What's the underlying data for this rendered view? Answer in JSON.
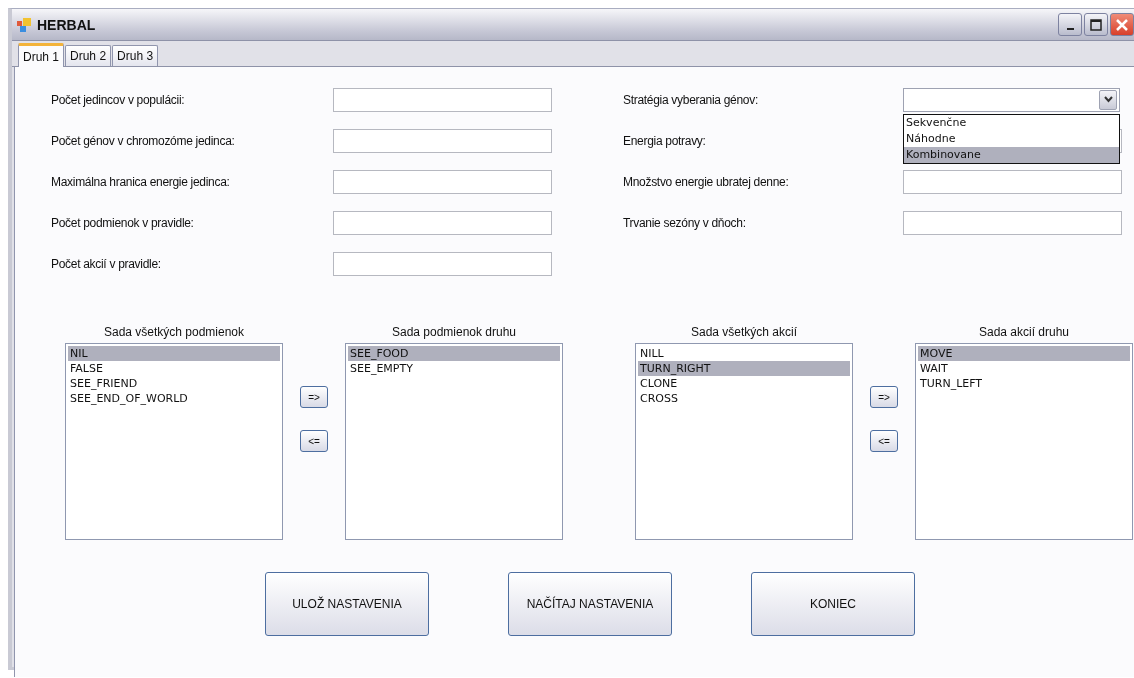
{
  "window": {
    "title": "HERBAL"
  },
  "tabs": [
    {
      "label": "Druh 1",
      "selected": true
    },
    {
      "label": "Druh 2",
      "selected": false
    },
    {
      "label": "Druh 3",
      "selected": false
    }
  ],
  "form_left": [
    {
      "label": "Počet jedincov v populácii:",
      "kind": "text"
    },
    {
      "label": "Počet génov v chromozóme jedinca:",
      "kind": "text"
    },
    {
      "label": "Maximálna hranica energie jedinca:",
      "kind": "text"
    },
    {
      "label": "Počet podmienok v pravidle:",
      "kind": "text"
    },
    {
      "label": "Počet akcií v pravidle:",
      "kind": "text"
    }
  ],
  "form_right": [
    {
      "label": "Stratégia vyberania génov:",
      "kind": "combo",
      "expanded": true,
      "options": [
        {
          "label": "Sekvenčne",
          "selected": false
        },
        {
          "label": "Náhodne",
          "selected": false
        },
        {
          "label": "Kombinovane",
          "selected": true
        }
      ]
    },
    {
      "label": "Energia potravy:",
      "kind": "text"
    },
    {
      "label": "Množstvo energie ubratej denne:",
      "kind": "text"
    },
    {
      "label": "Trvanie sezóny v dňoch:",
      "kind": "text"
    }
  ],
  "list_groups": [
    {
      "source": {
        "title": "Sada všetkých podmienok",
        "items": [
          {
            "label": "NIL",
            "selected": true
          },
          {
            "label": "FALSE",
            "selected": false
          },
          {
            "label": "SEE_FRIEND",
            "selected": false
          },
          {
            "label": "SEE_END_OF_WORLD",
            "selected": false
          }
        ]
      },
      "transfer": [
        "=>",
        "<="
      ],
      "target": {
        "title": "Sada podmienok druhu",
        "items": [
          {
            "label": "SEE_FOOD",
            "selected": true
          },
          {
            "label": "SEE_EMPTY",
            "selected": false
          }
        ]
      }
    },
    {
      "source": {
        "title": "Sada všetkých akcií",
        "items": [
          {
            "label": "NILL",
            "selected": false
          },
          {
            "label": "TURN_RIGHT",
            "selected": true
          },
          {
            "label": "CLONE",
            "selected": false
          },
          {
            "label": "CROSS",
            "selected": false
          }
        ]
      },
      "transfer": [
        "=>",
        "<="
      ],
      "target": {
        "title": "Sada akcií druhu",
        "items": [
          {
            "label": "MOVE",
            "selected": true
          },
          {
            "label": "WAIT",
            "selected": false
          },
          {
            "label": "TURN_LEFT",
            "selected": false
          }
        ]
      }
    }
  ],
  "buttons": [
    "ULOŽ NASTAVENIA",
    "NAČÍTAJ NASTAVENIA",
    "KONIEC"
  ]
}
